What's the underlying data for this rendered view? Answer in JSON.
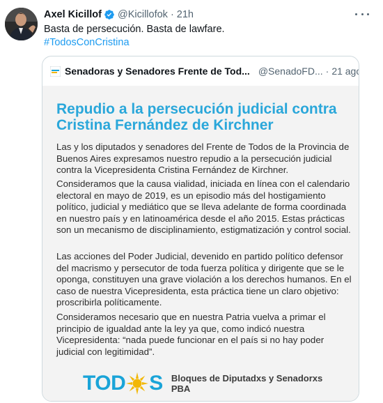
{
  "tweet": {
    "author_name": "Axel Kicillof",
    "author_handle": "@Kicillofok",
    "separator": "·",
    "time": "21h",
    "text": "Basta de persecución. Basta de lawfare.",
    "hashtag": "#TodosConCristina",
    "verified_color": "#1d9bf0"
  },
  "quote": {
    "author_name": "Senadoras y Senadores Frente de Tod...",
    "author_handle": "@SenadoFD...",
    "separator": "·",
    "time": "21 ago.",
    "image": {
      "headline": "Repudio a la persecución judicial contra Cristina Fernández de Kirchner",
      "paragraphs": [
        "Las y los diputados y senadores del Frente de Todos de la Provincia de Buenos Aires expresamos nuestro repudio a la persecución judicial contra la Vicepresidenta Cristina Fernández de Kirchner.",
        "Consideramos que la causa vialidad, iniciada en línea con el calendario electoral en mayo de 2019, es un episodio más del hostigamiento político, judicial y mediático que se lleva adelante de forma coordinada en nuestro país y en latinoamérica desde el año 2015. Estas prácticas son un mecanismo de disciplinamiento, estigmatización y control social.",
        "Las acciones del Poder Judicial, devenido en partido político defensor del macrismo y persecutor de toda fuerza política y dirigente que se le oponga, constituyen una grave violación a los derechos humanos. En el caso de nuestra Vicepresidenta, esta práctica tiene un claro objetivo: proscribirla políticamente.",
        "Consideramos necesario que en nuestra Patria vuelva a primar el principio de igualdad ante la ley ya que, como indicó nuestra Vicepresidenta: “nada puede funcionar en el país si no hay poder judicial con legitimidad”."
      ],
      "logo_left": "TOD",
      "logo_right": "S",
      "caption_line1": "Bloques de Diputadxs y Senadorxs",
      "caption_line2": "PBA",
      "headline_color": "#2aa7da",
      "logo_color": "#1aa4d8",
      "sun_color": "#f2b705"
    }
  },
  "icons": {
    "more": "more-icon",
    "verified": "verified-badge-icon",
    "quote_logo": "account-logo-icon",
    "sun": "sun-icon"
  }
}
